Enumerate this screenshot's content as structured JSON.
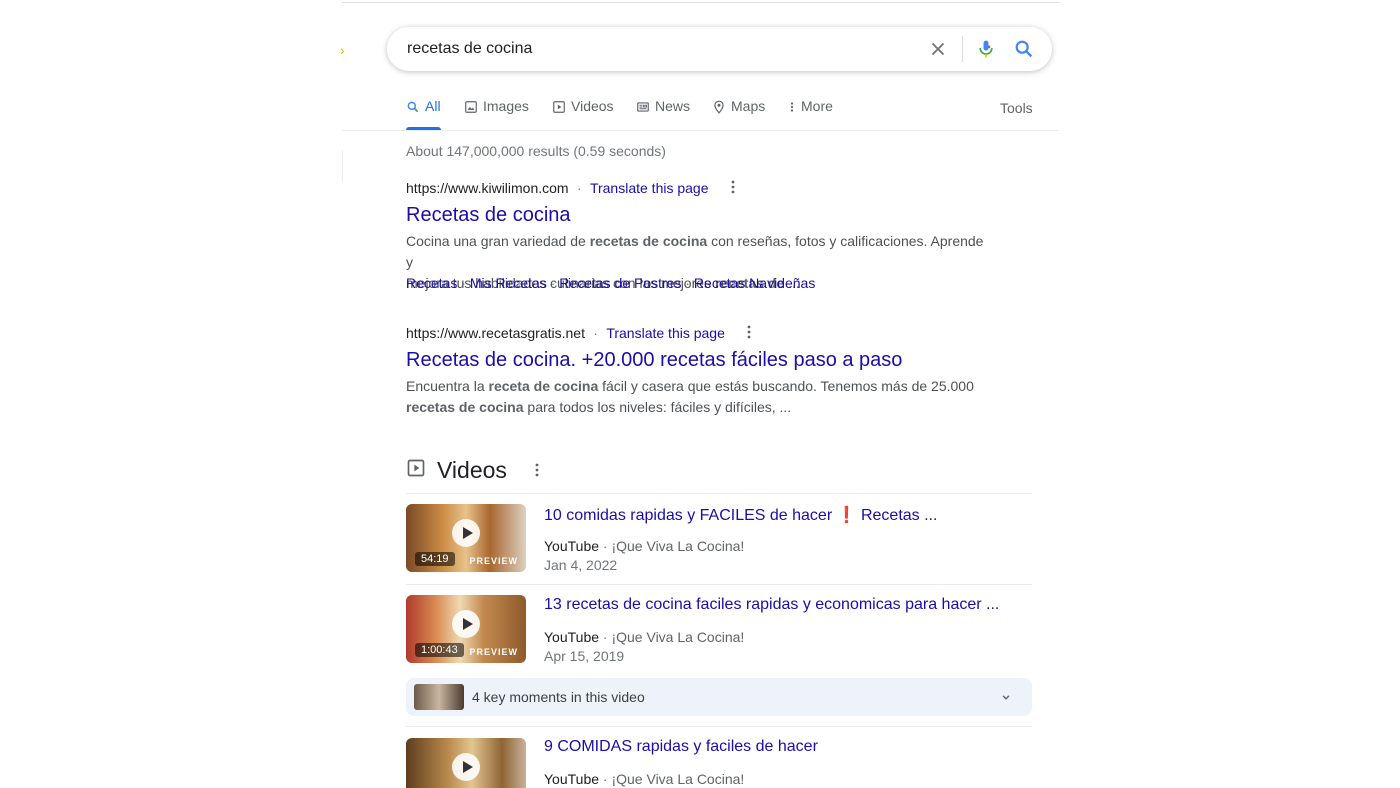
{
  "search": {
    "query": "recetas de cocina"
  },
  "tabs": [
    {
      "label": "All",
      "icon": "search-icon",
      "active": true
    },
    {
      "label": "Images",
      "icon": "image-icon"
    },
    {
      "label": "Videos",
      "icon": "video-icon"
    },
    {
      "label": "News",
      "icon": "news-icon"
    },
    {
      "label": "Maps",
      "icon": "map-pin-icon"
    },
    {
      "label": "More",
      "icon": "more-vert-icon"
    }
  ],
  "tools_label": "Tools",
  "stats": "About 147,000,000 results (0.59 seconds)",
  "results": [
    {
      "url": "https://www.kiwilimon.com",
      "translate": "Translate this page",
      "title": "Recetas de cocina",
      "snippet_line1_a": "Cocina una gran variedad de ",
      "snippet_line1_b": "recetas de cocina",
      "snippet_line1_c": " con reseñas, fotos y calificaciones. Aprende y",
      "snippet_line2_a": "mejora tus habilidades culinarias con las mejores ",
      "snippet_line2_b": "recetas de",
      "snippet_line2_c": " ...",
      "sitelinks": [
        "Recetas",
        "Mis Recetas",
        "Recetas de Postres",
        "Recetas Navideñas"
      ]
    },
    {
      "url": "https://www.recetasgratis.net",
      "translate": "Translate this page",
      "title": "Recetas de cocina. +20.000 recetas fáciles paso a paso",
      "snippet_line1_a": "Encuentra la ",
      "snippet_line1_b": "receta de cocina",
      "snippet_line1_c": " fácil y casera que estás buscando. Tenemos más de 25.000",
      "snippet_line2_a": "",
      "snippet_line2_b": "recetas de cocina",
      "snippet_line2_c": " para todos los niveles: fáciles y difíciles, ..."
    }
  ],
  "videos": {
    "heading": "Videos",
    "items": [
      {
        "title": "10 comidas rapidas y FACILES de hacer ❗ Recetas ...",
        "source": "YouTube",
        "channel": "¡Que Viva La Cocina!",
        "date": "Jan 4, 2022",
        "duration": "54:19",
        "preview": "PREVIEW"
      },
      {
        "title": "13 recetas de cocina faciles rapidas y economicas para hacer ...",
        "source": "YouTube",
        "channel": "¡Que Viva La Cocina!",
        "date": "Apr 15, 2019",
        "duration": "1:00:43",
        "preview": "PREVIEW"
      },
      {
        "title": "9 COMIDAS rapidas y faciles de hacer",
        "source": "YouTube",
        "channel": "¡Que Viva La Cocina!"
      }
    ],
    "key_moments": "4 key moments in this video"
  },
  "colors": {
    "link": "#1a0dab",
    "accent": "#1a73e8",
    "muted": "#70757a"
  }
}
